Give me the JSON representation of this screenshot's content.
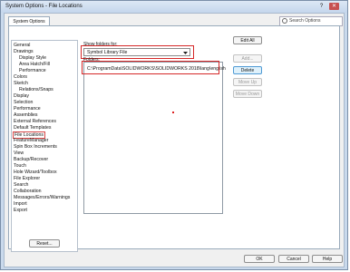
{
  "window": {
    "title": "System Options - File Locations"
  },
  "tabs": {
    "system_options": "System Options"
  },
  "search": {
    "placeholder": "Search Options"
  },
  "tree": {
    "items": [
      {
        "label": "General"
      },
      {
        "label": "Drawings"
      },
      {
        "label": "Display Style"
      },
      {
        "label": "Area Hatch/Fill"
      },
      {
        "label": "Performance"
      },
      {
        "label": "Colors"
      },
      {
        "label": "Sketch"
      },
      {
        "label": "Relations/Snaps"
      },
      {
        "label": "Display"
      },
      {
        "label": "Selection"
      },
      {
        "label": "Performance"
      },
      {
        "label": "Assemblies"
      },
      {
        "label": "External References"
      },
      {
        "label": "Default Templates"
      },
      {
        "label": "File Locations"
      },
      {
        "label": "FeatureManager"
      },
      {
        "label": "Spin Box Increments"
      },
      {
        "label": "View"
      },
      {
        "label": "Backup/Recover"
      },
      {
        "label": "Touch"
      },
      {
        "label": "Hole Wizard/Toolbox"
      },
      {
        "label": "File Explorer"
      },
      {
        "label": "Search"
      },
      {
        "label": "Collaboration"
      },
      {
        "label": "Messages/Errors/Warnings"
      },
      {
        "label": "Import"
      },
      {
        "label": "Export"
      }
    ]
  },
  "show_folders_for": {
    "label": "Show folders for:",
    "value": "Symbol Library File"
  },
  "folders": {
    "label": "Folders:",
    "items": [
      "C:\\ProgramData\\SOLIDWORKS\\SOLIDWORKS 2018\\lang\\english"
    ]
  },
  "buttons": {
    "edit_all": "Edit All",
    "add": "Add...",
    "delete": "Delete",
    "move_up": "Move Up",
    "move_down": "Move Down",
    "reset": "Reset...",
    "ok": "OK",
    "cancel": "Cancel",
    "help": "Help"
  },
  "titlebar_buttons": {
    "help": "?",
    "close": "✕"
  }
}
